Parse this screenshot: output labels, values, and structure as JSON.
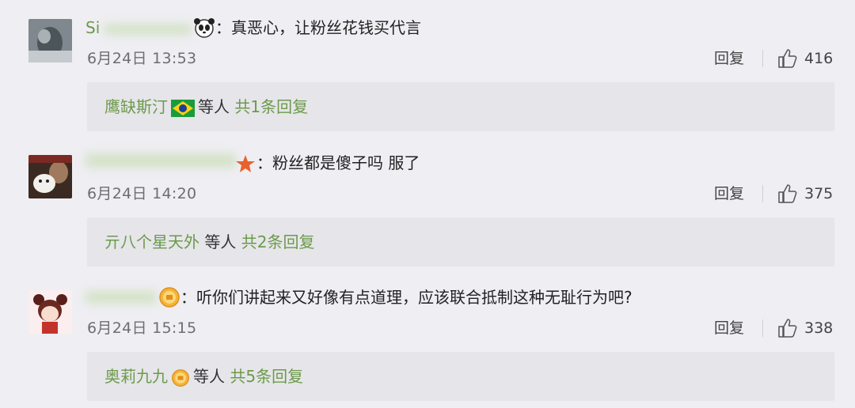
{
  "comments": [
    {
      "username": "Si",
      "content": "：真恶心，让粉丝花钱买代言",
      "time": "6月24日 13:53",
      "reply_label": "回复",
      "likes": "416",
      "replies": {
        "name": "鹰缺斯汀",
        "suffix": "等人",
        "count_text": "共1条回复"
      }
    },
    {
      "username": "",
      "content": "：粉丝都是傻子吗 服了",
      "time": "6月24日 14:20",
      "reply_label": "回复",
      "likes": "375",
      "replies": {
        "name": "亓八个星天外",
        "suffix": "等人",
        "count_text": "共2条回复"
      }
    },
    {
      "username": "",
      "content": "：听你们讲起来又好像有点道理，应该联合抵制这种无耻行为吧?",
      "time": "6月24日 15:15",
      "reply_label": "回复",
      "likes": "338",
      "replies": {
        "name": "奥莉九九",
        "suffix": "等人",
        "count_text": "共5条回复"
      }
    }
  ],
  "icons": {
    "badge_1": "panda-icon",
    "badge_2": "star-badge-icon",
    "badge_3": "gold-medal-icon",
    "reply_badge_1": "brazil-flag-icon",
    "reply_badge_3": "gold-medal-icon",
    "like": "thumbs-up-icon"
  },
  "colors": {
    "background": "#efeef3",
    "username_green": "#6c9a4a",
    "reply_box": "#e6e5ea"
  }
}
